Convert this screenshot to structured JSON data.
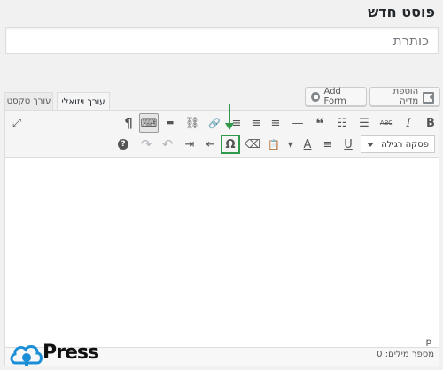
{
  "page": {
    "title": "פוסט חדש"
  },
  "title_field": {
    "placeholder": "כותרת"
  },
  "buttons": {
    "add_media": "הוספת מדיה",
    "add_form": "Add Form"
  },
  "tabs": {
    "visual": "עורך ויזואלי",
    "text": "עורך טקסט"
  },
  "toolbar": {
    "row1": [
      {
        "name": "bold-icon",
        "glyph": "B"
      },
      {
        "name": "italic-icon",
        "glyph": "I"
      },
      {
        "name": "strikethrough-icon",
        "glyph": "ABC"
      },
      {
        "name": "bulleted-list-icon",
        "glyph": "☰"
      },
      {
        "name": "numbered-list-icon",
        "glyph": "☷"
      },
      {
        "name": "blockquote-icon",
        "glyph": "❝"
      },
      {
        "name": "horizontal-line-icon",
        "glyph": "—"
      },
      {
        "name": "align-left-icon",
        "glyph": "≡"
      },
      {
        "name": "align-center-icon",
        "glyph": "≡"
      },
      {
        "name": "align-right-icon",
        "glyph": "≡"
      },
      {
        "name": "insert-link-icon",
        "glyph": "🔗"
      },
      {
        "name": "remove-link-icon",
        "glyph": "⛓"
      },
      {
        "name": "read-more-icon",
        "glyph": "▬"
      },
      {
        "name": "toolbar-toggle-icon",
        "glyph": "⌨"
      },
      {
        "name": "rtl-paragraph-icon",
        "glyph": "¶"
      },
      {
        "name": "fullscreen-icon",
        "glyph": "⤢"
      }
    ],
    "format_select": "פסקה רגילה",
    "row2": [
      {
        "name": "underline-icon",
        "glyph": "U"
      },
      {
        "name": "justify-icon",
        "glyph": "≡"
      },
      {
        "name": "text-color-icon",
        "glyph": "A"
      },
      {
        "name": "paste-as-text-icon",
        "glyph": "📋"
      },
      {
        "name": "clear-formatting-icon",
        "glyph": "⌫"
      },
      {
        "name": "special-character-icon",
        "glyph": "Ω"
      },
      {
        "name": "outdent-icon",
        "glyph": "⇤"
      },
      {
        "name": "indent-icon",
        "glyph": "⇥"
      },
      {
        "name": "undo-icon",
        "glyph": "↶"
      },
      {
        "name": "redo-icon",
        "glyph": "↷"
      },
      {
        "name": "help-icon",
        "glyph": "?"
      }
    ]
  },
  "editor": {
    "path": "p"
  },
  "word_count": "מספר מילים: 0",
  "logo": {
    "text": "Press"
  },
  "colors": {
    "highlight": "#2e9a4a",
    "logo_blue": "#1a8fd8"
  }
}
